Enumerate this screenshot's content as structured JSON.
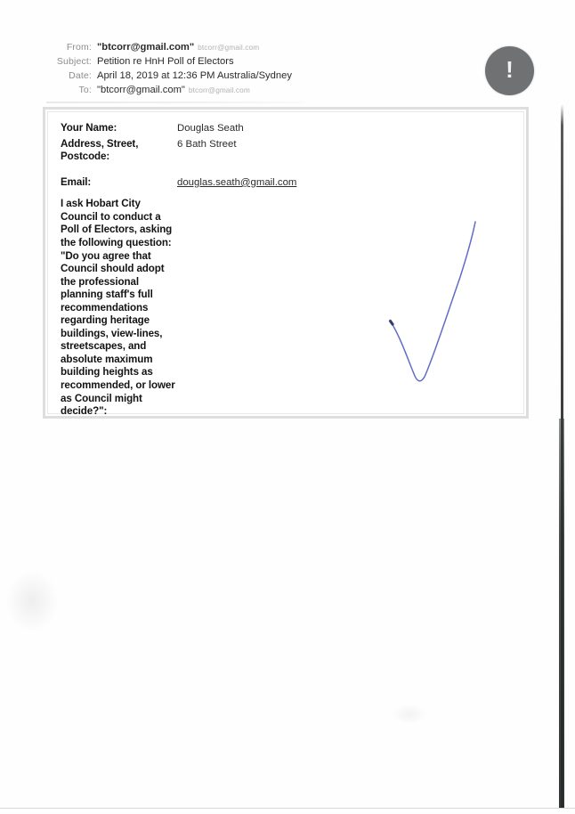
{
  "email_header": {
    "rows": [
      {
        "label": "From:",
        "value": "\"btcorr@gmail.com\"",
        "secondary": "btcorr@gmail.com",
        "bold": true
      },
      {
        "label": "Subject:",
        "value": "Petition re HnH Poll of Electors",
        "secondary": "",
        "bold": false
      },
      {
        "label": "Date:",
        "value": "April 18, 2019 at 12:36 PM Australia/Sydney",
        "secondary": "",
        "bold": false
      },
      {
        "label": "To:",
        "value": "\"btcorr@gmail.com\"",
        "secondary": "btcorr@gmail.com",
        "bold": false
      }
    ]
  },
  "badge": {
    "symbol": "!",
    "color": "#6f7173"
  },
  "form": {
    "fields": [
      {
        "label": "Your Name:",
        "value": "Douglas Seath"
      },
      {
        "label": "Address, Street, Postcode:",
        "value": "6 Bath Street"
      },
      {
        "label": "Email:",
        "value": "douglas.seath@gmail.com"
      }
    ],
    "petition_request": "I ask Hobart City Council to conduct a Poll of Electors, asking the following question: \"Do you agree that Council should adopt the professional planning staff's full recommendations regarding heritage buildings, view-lines, streetscapes, and absolute maximum building heights as recommended, or lower as Council might decide?\":",
    "annotation": {
      "type": "handwritten-check-mark",
      "ink_color": "#5560c0"
    }
  }
}
